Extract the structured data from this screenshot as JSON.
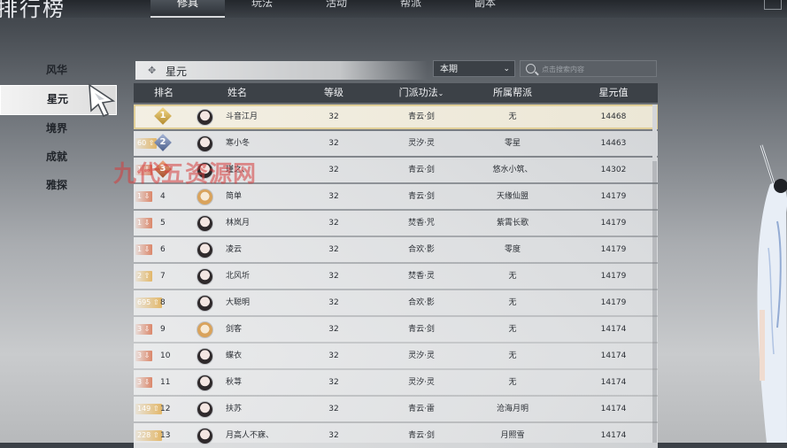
{
  "window_title": "排行榜",
  "tabs": [
    {
      "label": "修具",
      "active": true
    },
    {
      "label": "玩法",
      "active": false
    },
    {
      "label": "活动",
      "active": false
    },
    {
      "label": "帮派",
      "active": false
    },
    {
      "label": "副本",
      "active": false
    }
  ],
  "sidebar": {
    "items": [
      {
        "label": "风华",
        "active": false
      },
      {
        "label": "星元",
        "active": true
      },
      {
        "label": "境界",
        "active": false
      },
      {
        "label": "成就",
        "active": false
      },
      {
        "label": "雅探",
        "active": false
      }
    ]
  },
  "category_title": "星元",
  "period_select": {
    "value": "本期"
  },
  "search": {
    "placeholder": "点击搜索内容"
  },
  "table": {
    "headers": {
      "rank": "排名",
      "name": "姓名",
      "level": "等级",
      "school": "门派功法",
      "guild": "所属帮派",
      "value": "星元值"
    },
    "rows": [
      {
        "rank": "1",
        "medal": "gold",
        "change": "",
        "change_dir": "",
        "name": "斗音江月",
        "level": "32",
        "school": "青云·剑",
        "guild": "无",
        "value": "14468"
      },
      {
        "rank": "2",
        "medal": "silver",
        "change": "60",
        "change_dir": "up",
        "name": "寒小冬",
        "level": "32",
        "school": "灵汐·灵",
        "guild": "零星",
        "value": "14463"
      },
      {
        "rank": "3",
        "medal": "bronze",
        "change": "1",
        "change_dir": "down",
        "name": "瑾之、",
        "level": "32",
        "school": "青云·剑",
        "guild": "悠水小筑、",
        "value": "14302"
      },
      {
        "rank": "4",
        "medal": "",
        "change": "1",
        "change_dir": "down",
        "name": "简单",
        "level": "32",
        "school": "青云·剑",
        "guild": "天缘仙盟",
        "value": "14179"
      },
      {
        "rank": "5",
        "medal": "",
        "change": "1",
        "change_dir": "down",
        "name": "林岚月",
        "level": "32",
        "school": "焚香·咒",
        "guild": "紫霄长歌",
        "value": "14179"
      },
      {
        "rank": "6",
        "medal": "",
        "change": "1",
        "change_dir": "down",
        "name": "凌云",
        "level": "32",
        "school": "合欢·影",
        "guild": "零度",
        "value": "14179"
      },
      {
        "rank": "7",
        "medal": "",
        "change": "2",
        "change_dir": "up",
        "name": "北风圻",
        "level": "32",
        "school": "焚香·灵",
        "guild": "无",
        "value": "14179"
      },
      {
        "rank": "8",
        "medal": "",
        "change": "695",
        "change_dir": "up",
        "name": "大聪明",
        "level": "32",
        "school": "合欢·影",
        "guild": "无",
        "value": "14179"
      },
      {
        "rank": "9",
        "medal": "",
        "change": "3",
        "change_dir": "down",
        "name": "剑客",
        "level": "32",
        "school": "青云·剑",
        "guild": "无",
        "value": "14174"
      },
      {
        "rank": "10",
        "medal": "",
        "change": "3",
        "change_dir": "down",
        "name": "蝶衣",
        "level": "32",
        "school": "灵汐·灵",
        "guild": "无",
        "value": "14174"
      },
      {
        "rank": "11",
        "medal": "",
        "change": "3",
        "change_dir": "down",
        "name": "秋荨",
        "level": "32",
        "school": "灵汐·灵",
        "guild": "无",
        "value": "14174"
      },
      {
        "rank": "12",
        "medal": "",
        "change": "149",
        "change_dir": "up",
        "name": "扶苏",
        "level": "32",
        "school": "青云·雷",
        "guild": "沧海月明",
        "value": "14174"
      },
      {
        "rank": "13",
        "medal": "",
        "change": "228",
        "change_dir": "up",
        "name": "月高人不寐、",
        "level": "32",
        "school": "青云·剑",
        "guild": "月照雪",
        "value": "14174"
      }
    ]
  },
  "watermark": "九代五资源网",
  "colors": {
    "header_bg": "#3c4147",
    "first_row_outline": "#e1cf98",
    "up": "#e2b25c",
    "down": "#da8264"
  }
}
